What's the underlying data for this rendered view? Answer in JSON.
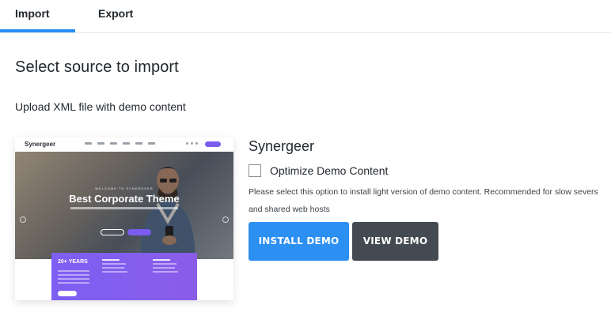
{
  "tabs": [
    {
      "label": "Import",
      "active": true
    },
    {
      "label": "Export",
      "active": false
    }
  ],
  "section_title": "Select source to import",
  "upload_text": "Upload XML file with demo content",
  "demo": {
    "name": "Synergeer",
    "preview": {
      "logo": "Synergeer",
      "headline": "Best Corporate Theme",
      "eyebrow": "WELCOME TO SYNERGEER",
      "badge": "20+ YEARS"
    },
    "optimize_label": "Optimize Demo Content",
    "optimize_checked": false,
    "help_text": "Please select this option to install light version of demo content. Recommended for slow severs and shared web hosts",
    "install_label": "INSTALL DEMO",
    "view_label": "VIEW DEMO"
  },
  "colors": {
    "accent": "#2c8ff2",
    "view_button": "#434a51",
    "preview_purple": "#7b5cf0"
  }
}
